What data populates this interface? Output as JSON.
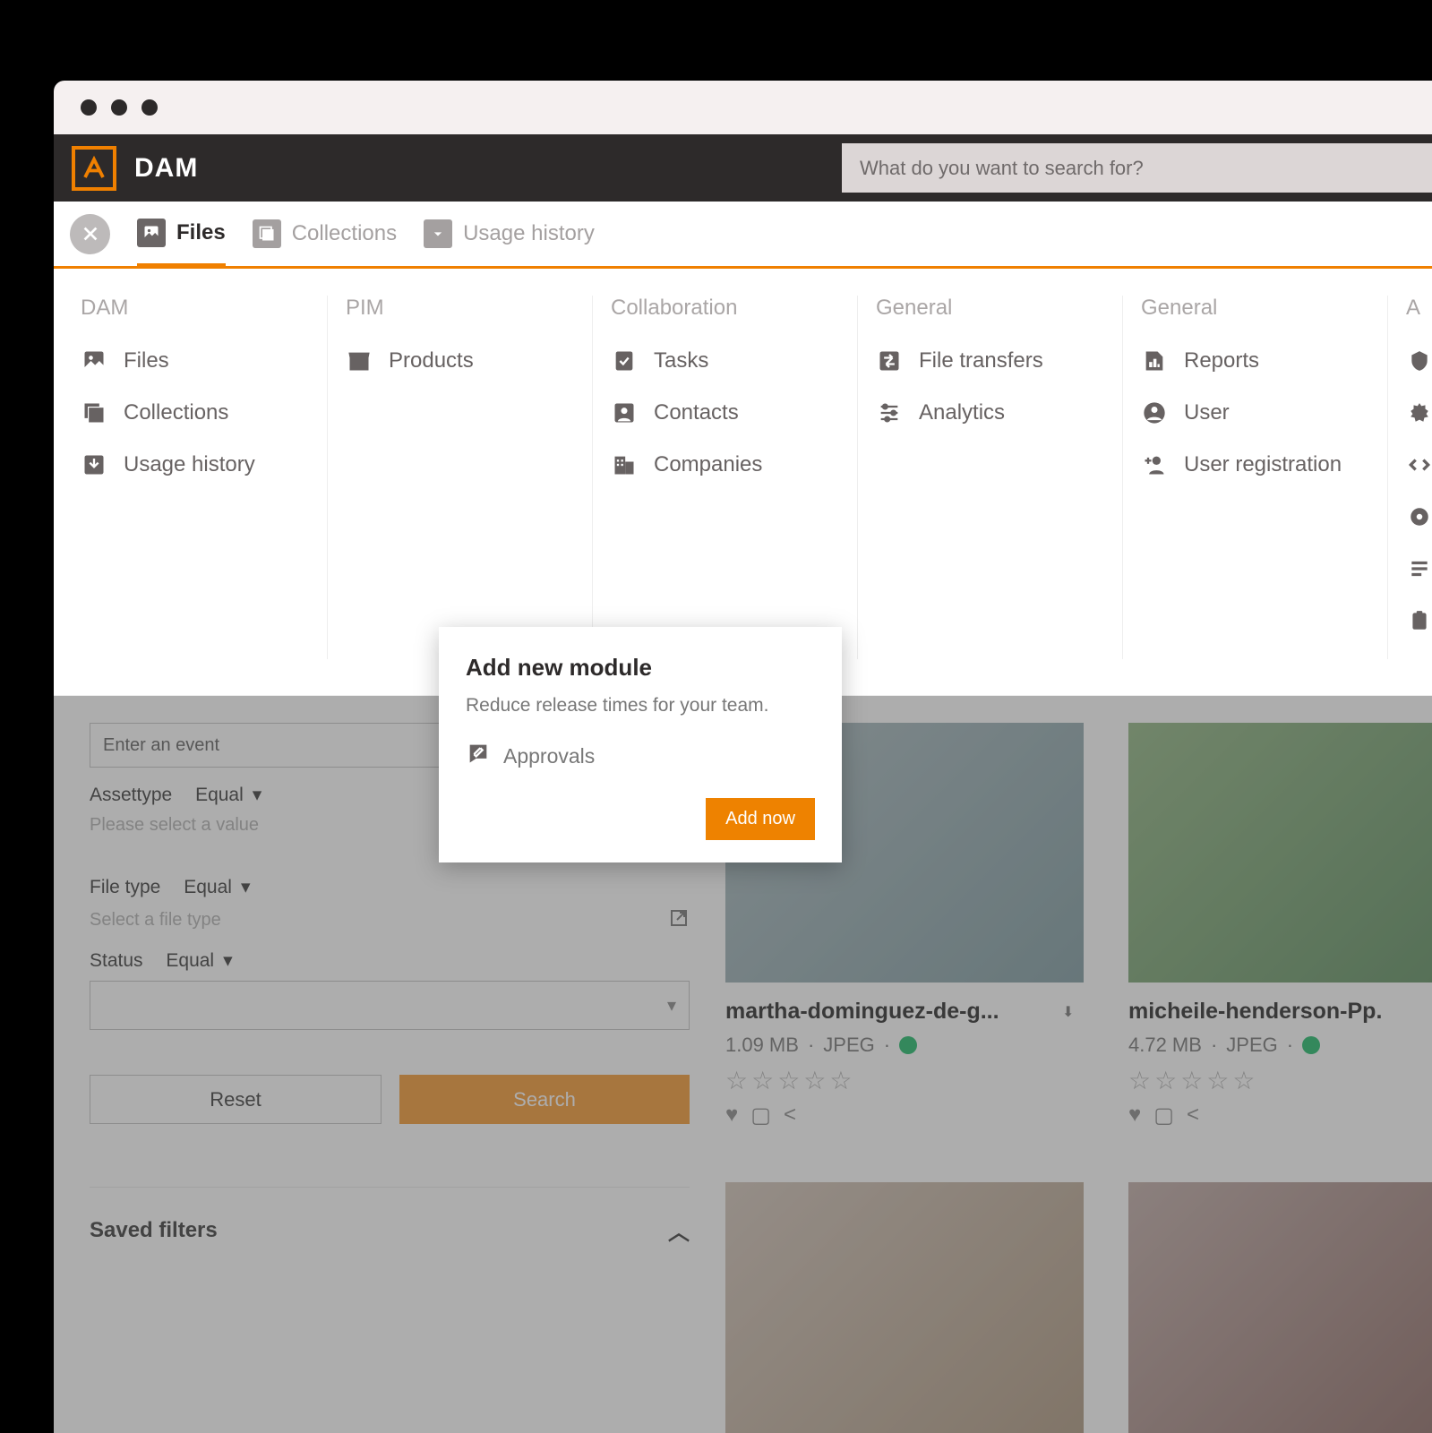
{
  "brand": "DAM",
  "search": {
    "placeholder": "What do you want to search for?"
  },
  "tabs": {
    "files": "Files",
    "collections": "Collections",
    "usage_history": "Usage history"
  },
  "megamenu": {
    "dam": {
      "header": "DAM",
      "files": "Files",
      "collections": "Collections",
      "usage_history": "Usage history"
    },
    "pim": {
      "header": "PIM",
      "products": "Products"
    },
    "collaboration": {
      "header": "Collaboration",
      "tasks": "Tasks",
      "contacts": "Contacts",
      "companies": "Companies"
    },
    "general1": {
      "header": "General",
      "file_transfers": "File transfers",
      "analytics": "Analytics"
    },
    "general2": {
      "header": "General",
      "reports": "Reports",
      "user": "User",
      "user_registration": "User registration"
    },
    "extra": {
      "header": "A"
    }
  },
  "popup": {
    "title": "Add new module",
    "desc": "Reduce release times for your team.",
    "item": "Approvals",
    "button": "Add now"
  },
  "filters": {
    "event_placeholder": "Enter an event",
    "assettype_label": "Assettype",
    "equal": "Equal",
    "assettype_placeholder": "Please select a value",
    "filetype_label": "File type",
    "filetype_placeholder": "Select a file type",
    "status_label": "Status",
    "reset": "Reset",
    "search": "Search",
    "saved": "Saved filters"
  },
  "cards": [
    {
      "title": "martha-dominguez-de-g...",
      "size": "1.09 MB",
      "type": "JPEG"
    },
    {
      "title": "micheile-henderson-Pp.",
      "size": "4.72 MB",
      "type": "JPEG"
    }
  ]
}
